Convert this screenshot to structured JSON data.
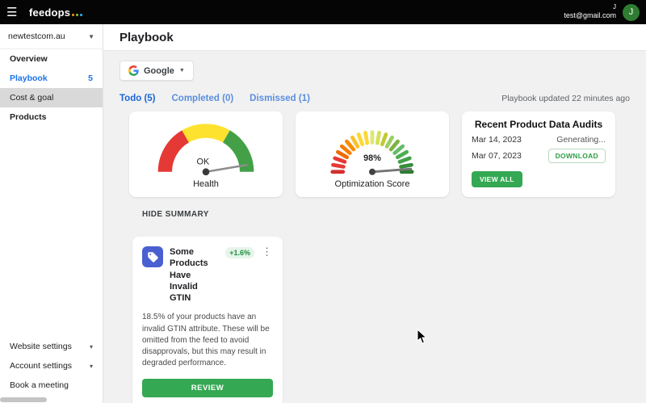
{
  "colors": {
    "accent_blue": "#1a73e8",
    "accent_green": "#34a853",
    "badge_green_bg": "#e6f4ea",
    "badge_green_text": "#1e8e3e",
    "gauge_red": "#e53935",
    "gauge_yellow": "#fdd835",
    "gauge_green": "#43a047"
  },
  "topbar": {
    "brand": "feedops",
    "user_name": "J",
    "user_email": "test@gmail.com",
    "avatar_initial": "J"
  },
  "sidebar": {
    "site_selector": "newtestcom.au",
    "items": [
      {
        "label": "Overview"
      },
      {
        "label": "Playbook",
        "badge": "5"
      },
      {
        "label": "Cost & goal"
      },
      {
        "label": "Products"
      }
    ],
    "footer_items": [
      {
        "label": "Website settings"
      },
      {
        "label": "Account settings"
      },
      {
        "label": "Book a meeting"
      }
    ]
  },
  "page": {
    "title": "Playbook"
  },
  "toolbar": {
    "channel_selector": "Google"
  },
  "tabs": [
    {
      "label": "Todo (5)"
    },
    {
      "label": "Completed (0)"
    },
    {
      "label": "Dismissed (1)"
    }
  ],
  "status": {
    "updated_text": "Playbook updated 22 minutes ago"
  },
  "summary": {
    "health": {
      "value": "OK",
      "label": "Health"
    },
    "optimization": {
      "value": "98%",
      "label": "Optimization Score"
    },
    "hide_label": "HIDE SUMMARY"
  },
  "audits": {
    "title": "Recent Product Data Audits",
    "rows": [
      {
        "date": "Mar 14, 2023",
        "status": "Generating..."
      },
      {
        "date": "Mar 07, 2023",
        "action": "DOWNLOAD"
      }
    ],
    "view_all": "VIEW ALL"
  },
  "task_card": {
    "icon": "tag-icon",
    "title": "Some Products Have Invalid GTIN",
    "delta": "+1.6%",
    "body": "18.5% of your products have an invalid GTIN attribute. These will be omitted from the feed to avoid disapprovals, but this may result in degraded performance.",
    "cta": "REVIEW"
  }
}
